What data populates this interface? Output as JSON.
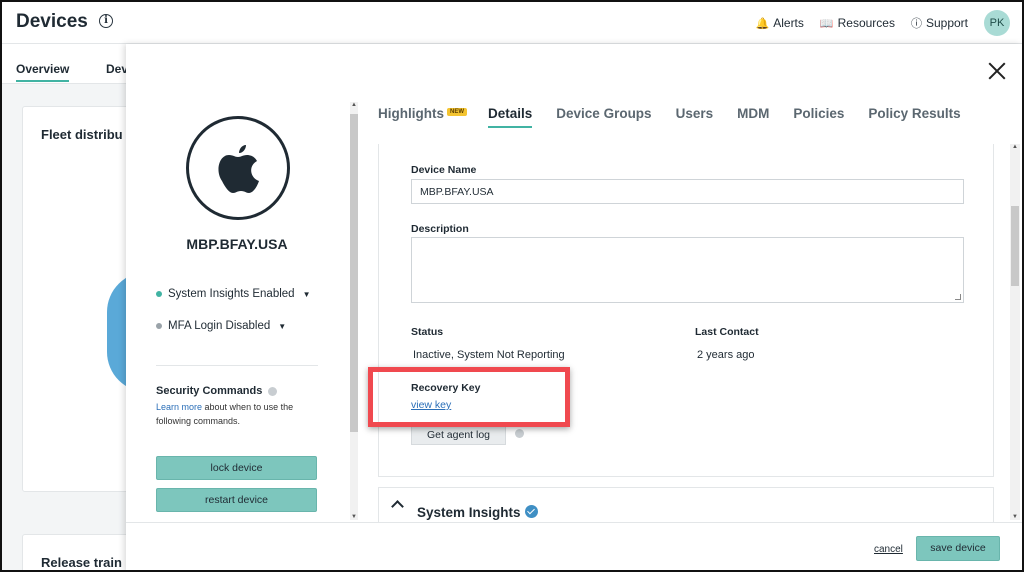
{
  "header": {
    "title": "Devices",
    "links": [
      {
        "label": "Alerts",
        "icon": "bell-icon"
      },
      {
        "label": "Resources",
        "icon": "book-icon"
      },
      {
        "label": "Support",
        "icon": "help-circle-icon"
      }
    ],
    "avatar_initials": "PK"
  },
  "background_page": {
    "tabs": [
      "Overview",
      "Dev"
    ],
    "cards": [
      "Fleet distribu",
      "Release train"
    ]
  },
  "device": {
    "name": "MBP.BFAY.USA",
    "logo_icon": "apple-logo-icon",
    "status_items": [
      {
        "label": "System Insights Enabled",
        "dot_color": "#41b3a3"
      },
      {
        "label": "MFA Login Disabled",
        "dot_color": "#9aa3a9"
      }
    ]
  },
  "security": {
    "title": "Security Commands",
    "learn_more": "Learn more",
    "description_rest": " about when to use the following commands.",
    "commands": [
      "lock device",
      "restart device"
    ]
  },
  "tabs": [
    {
      "label": "Highlights",
      "badge": "NEW"
    },
    {
      "label": "Details",
      "active": true
    },
    {
      "label": "Device Groups"
    },
    {
      "label": "Users"
    },
    {
      "label": "MDM"
    },
    {
      "label": "Policies"
    },
    {
      "label": "Policy Results"
    }
  ],
  "details": {
    "device_name_label": "Device Name",
    "device_name_value": "MBP.BFAY.USA",
    "description_label": "Description",
    "description_value": "",
    "status_label": "Status",
    "status_value": "Inactive, System Not Reporting",
    "last_contact_label": "Last Contact",
    "last_contact_value": "2 years ago",
    "recovery_key_label": "Recovery Key",
    "view_key_link": "view key",
    "agent_log_button": "Get agent log"
  },
  "system_insights": {
    "title": "System Insights"
  },
  "footer": {
    "cancel": "cancel",
    "save": "save device"
  },
  "colors": {
    "accent": "#41b3a3",
    "button": "#7dc6bd",
    "highlight": "#f0494f",
    "link": "#2b6fb8"
  }
}
